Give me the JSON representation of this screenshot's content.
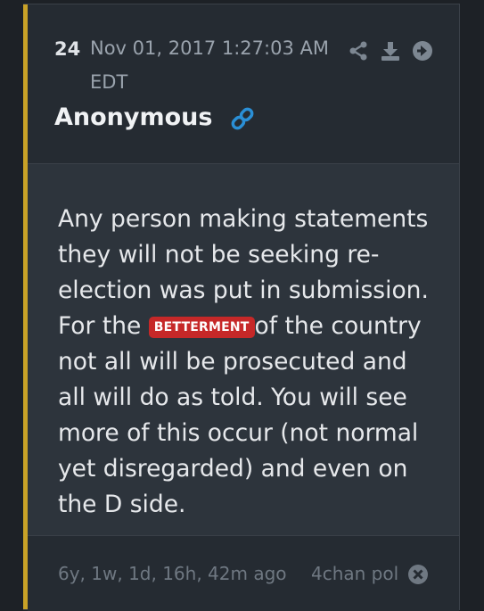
{
  "post": {
    "number": "24",
    "date": "Nov 01, 2017 1:27:03 AM EDT",
    "author": "Anonymous",
    "message": {
      "before": "Any person making statements they will not be seeking re-election was put in submission. For the ",
      "highlight": "BETTERMENT",
      "after": "of the country not all will be prosecuted and all will do as told. You will see more of this occur (not normal yet disregarded) and even on the D side."
    },
    "age": "6y, 1w, 1d, 16h, 42m ago",
    "source": "4chan pol"
  },
  "icons": {
    "share": "share-icon",
    "download": "download-icon",
    "go": "arrow-right-circle-icon",
    "link": "link-icon",
    "close": "close-circle-icon"
  },
  "colors": {
    "accent": "#c9a227",
    "link": "#2a8fd6",
    "badge": "#c62828",
    "background": "#1d2126",
    "card": "#252b32",
    "body": "#2d343c"
  }
}
